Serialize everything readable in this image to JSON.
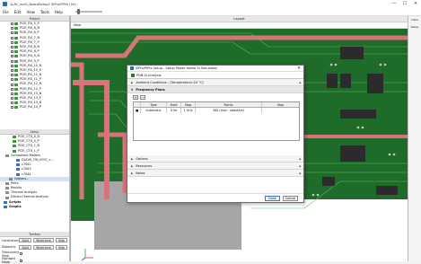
{
  "window": {
    "title": "1LAY_multi_BoardSetup2 SIPro/PIPro (04)",
    "minimize": "—",
    "maximize": "☐",
    "close": "✕"
  },
  "menu": [
    "File",
    "Edit",
    "View",
    "Tools",
    "Help"
  ],
  "project_panel": {
    "title": "Project",
    "nets": [
      "PCIE_RX_5_P",
      "PCIE_RX_6_N",
      "PCIE_RX_6_P",
      "PCIE_RX_7_N",
      "PCIE_RX_7_P",
      "PCIE_RX_8_N",
      "PCIE_RX_8_P",
      "PCIE_RX_9_N",
      "PCIE_RX_9_P",
      "PCIE_RX_10_N",
      "PCIE_RX_10_P",
      "PCIE_RX_11_N",
      "PCIE_RX_11_P",
      "PCIE_RX_12_N",
      "PCIE_RX_12_P",
      "PCIE_RX_13_N",
      "PCIE_RX_13_P",
      "PCIE_RX_14_N",
      "PCIE_RX_14_P"
    ]
  },
  "setup_panel": {
    "title": "Setup",
    "items": [
      {
        "label": "PCIE_CTX_0_N",
        "type": "net"
      },
      {
        "label": "PCIE_CTX_0_P",
        "type": "net"
      },
      {
        "label": "PCIE_CTX_1_N",
        "type": "net"
      },
      {
        "label": "PCIE_CTX_1_P",
        "type": "net"
      },
      {
        "label": "Component Models",
        "type": "folder"
      },
      {
        "label": "DLEVK_TIN_0037_c...",
        "type": "model"
      },
      {
        "label": "c7042",
        "type": "model"
      },
      {
        "label": "c7043",
        "type": "model"
      },
      {
        "label": "c7044",
        "type": "model"
      },
      {
        "label": "Options...",
        "type": "option",
        "selected": true
      },
      {
        "label": "Ports",
        "type": "folder"
      },
      {
        "label": "Results",
        "type": "folder"
      },
      {
        "label": "Thermal Analysis",
        "type": "folder"
      },
      {
        "label": "Electro-Thermal Analysis",
        "type": "folder"
      },
      {
        "label": "Scripts",
        "type": "bold"
      },
      {
        "label": "Graphs",
        "type": "bold"
      }
    ]
  },
  "toolbox": {
    "title": "Toolbox",
    "rows": [
      {
        "label": "Conductors",
        "buttons": [
          "Solid",
          "Wireframe",
          "Hide"
        ]
      },
      {
        "label": "Dielectric",
        "buttons": [
          "Solid",
          "Wireframe",
          "Hide"
        ]
      },
      {
        "label": "Translucent View",
        "buttons": []
      },
      {
        "label": "Highlight Mode",
        "buttons": []
      }
    ]
  },
  "layout": {
    "title": "Layout",
    "view_label": "View",
    "colors": {
      "board": "#1f6b2a",
      "copper": "#3a9b3a",
      "trace_red": "#d8737a",
      "background": "#ffffff",
      "gray_plane": "#a6a6a6"
    }
  },
  "right_strip": [
    "Data",
    "Setup"
  ],
  "dialog": {
    "title": "SIPro/PIPro Setup - Setup Power Aware SI Simulation",
    "analysis": "PDN-SI Analysis",
    "ambient": "Ambient Conditions - (Temperature=25 °C)",
    "frequency_plan": "Frequency Plans",
    "toolbar": [
      "+",
      "—"
    ],
    "table": {
      "headers": [
        "",
        "Type",
        "Start",
        "Stop",
        "Points",
        "Step"
      ],
      "rows": [
        [
          "",
          "Automatic",
          "0 Hz",
          "1 GHz",
          "300 (max - adaptive)",
          ""
        ]
      ]
    },
    "sections": [
      "Options",
      "Resources",
      "Notes"
    ],
    "buttons": [
      "Done",
      "Cancel"
    ]
  }
}
